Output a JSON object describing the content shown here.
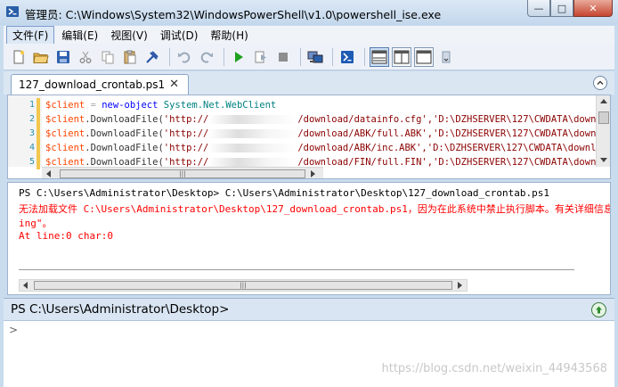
{
  "window": {
    "title": "管理员: C:\\Windows\\System32\\WindowsPowerShell\\v1.0\\powershell_ise.exe",
    "minimize_glyph": "—",
    "maximize_glyph": "□",
    "close_glyph": "✕"
  },
  "menu": {
    "items": [
      {
        "label": "文件(F)"
      },
      {
        "label": "编辑(E)"
      },
      {
        "label": "视图(V)"
      },
      {
        "label": "调试(D)"
      },
      {
        "label": "帮助(H)"
      }
    ]
  },
  "toolbar": {
    "icons": [
      "new-file-icon",
      "open-folder-icon",
      "save-icon",
      "cut-icon",
      "copy-icon",
      "paste-icon",
      "clear-icon",
      "undo-icon",
      "redo-icon",
      "run-icon",
      "run-selection-icon",
      "stop-icon",
      "remote-powershell-icon",
      "powershell-icon",
      "layout-script-top-icon",
      "layout-script-right-icon",
      "layout-script-max-icon"
    ]
  },
  "tab": {
    "label": "127_download_crontab.ps1",
    "close_glyph": "✕"
  },
  "editor": {
    "lines": [
      {
        "num": "1",
        "parts": [
          [
            "var",
            "$client"
          ],
          [
            "op",
            " = "
          ],
          [
            "cmd",
            "new-object"
          ],
          [
            "plain",
            " "
          ],
          [
            "type",
            "System.Net.WebClient"
          ]
        ]
      },
      {
        "num": "2",
        "parts": [
          [
            "var",
            "$client"
          ],
          [
            "plain",
            ".DownloadFile("
          ],
          [
            "str",
            "'http://"
          ]
        ],
        "tail": "/download/datainfo.cfg','D:\\DZHSERVER\\127\\CWDATA\\downlo"
      },
      {
        "num": "3",
        "parts": [
          [
            "var",
            "$client"
          ],
          [
            "plain",
            ".DownloadFile("
          ],
          [
            "str",
            "'http://"
          ]
        ],
        "tail": "/download/ABK/full.ABK','D:\\DZHSERVER\\127\\CWDATA\\downlo"
      },
      {
        "num": "4",
        "parts": [
          [
            "var",
            "$client"
          ],
          [
            "plain",
            ".DownloadFile("
          ],
          [
            "str",
            "'http://"
          ]
        ],
        "tail": "/download/ABK/inc.ABK','D:\\DZHSERVER\\127\\CWDATA\\download"
      },
      {
        "num": "5",
        "parts": [
          [
            "var",
            "$client"
          ],
          [
            "plain",
            ".DownloadFile("
          ],
          [
            "str",
            "'http://"
          ]
        ],
        "tail": "/download/FIN/full.FIN','D:\\DZHSERVER\\127\\CWDATA\\downlo"
      }
    ],
    "hscroll_thumb_glyph": "|||"
  },
  "output": {
    "line1": "PS C:\\Users\\Administrator\\Desktop> C:\\Users\\Administrator\\Desktop\\127_download_crontab.ps1",
    "err1": "无法加载文件 C:\\Users\\Administrator\\Desktop\\127_download_crontab.ps1，因为在此系统中禁止执行脚本。有关详细信息，",
    "err2": "ing\"。",
    "err3": "At line:0 char:0",
    "hscroll_thumb_glyph": "|||"
  },
  "command": {
    "prompt": "PS C:\\Users\\Administrator\\Desktop>",
    "caret": ">"
  },
  "watermark": "https://blog.csdn.net/weixin_44943568",
  "colors": {
    "variable": "#ff4500",
    "string": "#8b0000",
    "command": "#0000ff",
    "type": "#008080",
    "error": "#ff0000"
  }
}
